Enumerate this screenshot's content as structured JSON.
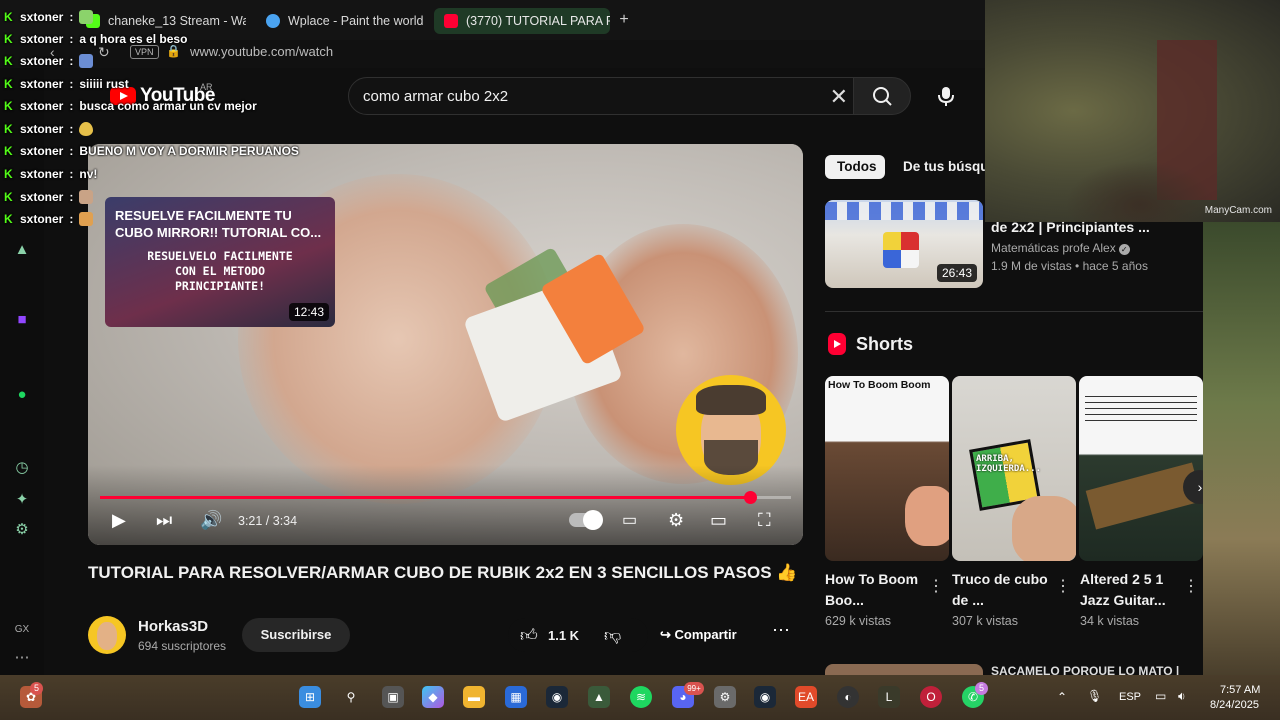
{
  "browser": {
    "tabs": [
      {
        "label": "chaneke_13 Stream - Watc",
        "color": "#53fc18"
      },
      {
        "label": "Wplace - Paint the world",
        "color": "#4aa3f0"
      },
      {
        "label": "(3770) TUTORIAL PARA R",
        "color": "#ff0033"
      }
    ],
    "vpn_label": "VPN",
    "url": "www.youtube.com/watch"
  },
  "youtube": {
    "logo_text": "YouTube",
    "country": "AR",
    "search_value": "como armar cubo 2x2"
  },
  "player": {
    "endcard_title": "RESUELVE FACILMENTE TU CUBO MIRROR!! TUTORIAL CO...",
    "endcard_text": "RESUELVELO FACILMENTE CON EL METODO PRINCIPIANTE!",
    "endcard_duration": "12:43",
    "time_current": "3:21",
    "time_total": "3:34",
    "time_display": "3:21 / 3:34",
    "progress": 0.94
  },
  "video": {
    "title": "TUTORIAL PARA RESOLVER/ARMAR CUBO DE RUBIK 2x2 EN 3 SENCILLOS PASOS 👍",
    "channel": "Horkas3D",
    "subscribers": "694 suscriptores",
    "subscribe_label": "Suscribirse",
    "likes": "1.1 K",
    "share_label": "Compartir"
  },
  "sidebar_right": {
    "chips": [
      "Todos",
      "De tus búsque"
    ],
    "recommended": {
      "title": "de 2x2 | Principiantes  ...",
      "channel": "Matemáticas profe Alex",
      "meta": "1.9 M de vistas • hace 5 años",
      "duration": "26:43"
    },
    "shorts_label": "Shorts",
    "shorts": [
      {
        "title": "How To Boom Boo...",
        "views": "629 k vistas",
        "thumb_text": "How To Boom Boom"
      },
      {
        "title": "Truco de cubo de ...",
        "views": "307 k vistas",
        "thumb_text": "ARRIBA, IZQUIERDA..."
      },
      {
        "title": "Altered 2 5 1 Jazz Guitar...",
        "views": "34 k vistas",
        "thumb_text": ""
      }
    ],
    "next_title": "SACAMELO PORQUE LO MATO |"
  },
  "webcam": {
    "watermark": "ManyCam.com"
  },
  "chat": [
    {
      "user": "sxtoner",
      "message": "",
      "emote": "#8bd36b"
    },
    {
      "user": "sxtoner",
      "message": "a q hora es el beso",
      "emote": ""
    },
    {
      "user": "sxtoner",
      "message": "",
      "emote": "#6b8dd3"
    },
    {
      "user": "sxtoner",
      "message": "siiiii rust",
      "emote": ""
    },
    {
      "user": "sxtoner",
      "message": "busca como armar un cv mejor",
      "emote": ""
    },
    {
      "user": "sxtoner",
      "message": "",
      "emote": "#e6c04a"
    },
    {
      "user": "sxtoner",
      "message": "BUENO M VOY A DORMIR PERUANOS",
      "emote": ""
    },
    {
      "user": "sxtoner",
      "message": "nv!",
      "emote": ""
    },
    {
      "user": "sxtoner",
      "message": "",
      "emote": "#c9a386"
    },
    {
      "user": "sxtoner",
      "message": "",
      "emote": "#e0a050"
    }
  ],
  "taskbar": {
    "lang": "ESP",
    "time": "7:57 AM",
    "date": "8/24/2025",
    "badge_left": "5",
    "badge_mail": "99+",
    "badge_whatsapp": "5"
  }
}
